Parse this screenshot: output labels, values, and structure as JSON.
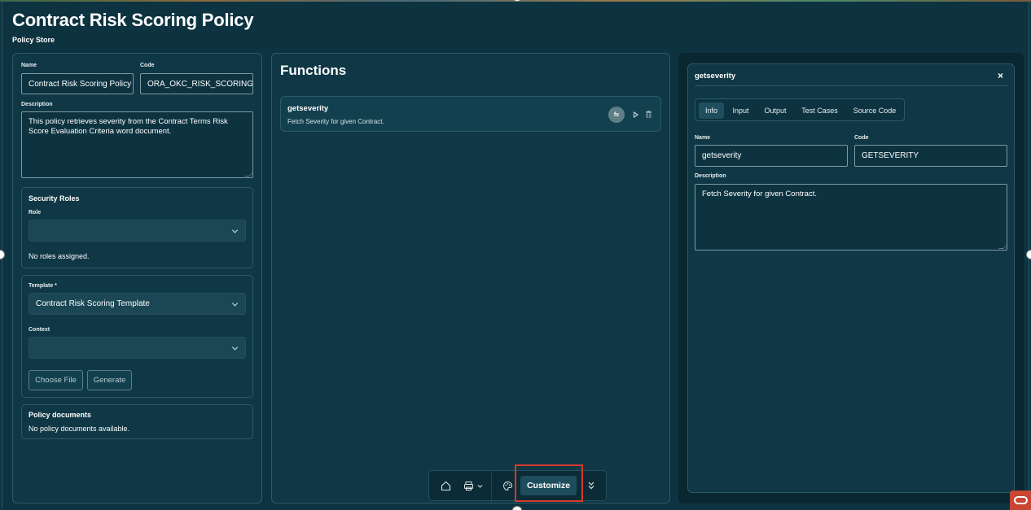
{
  "header": {
    "title": "Contract Risk Scoring Policy",
    "subtitle": "Policy Store"
  },
  "policy_form": {
    "name_label": "Name",
    "name_value": "Contract Risk Scoring Policy",
    "code_label": "Code",
    "code_value": "ORA_OKC_RISK_SCORING_P(",
    "description_label": "Description",
    "description_value": "This policy retrieves severity from the Contract Terms Risk Score Evaluation Criteria word document."
  },
  "security_roles": {
    "title": "Security Roles",
    "role_label": "Role",
    "role_value": "",
    "empty_text": "No roles assigned."
  },
  "template_section": {
    "template_label": "Template *",
    "template_value": "Contract Risk Scoring Template",
    "context_label": "Context",
    "context_value": "",
    "choose_file_label": "Choose File",
    "generate_label": "Generate"
  },
  "policy_documents": {
    "title": "Policy documents",
    "empty_text": "No policy documents available."
  },
  "functions": {
    "title": "Functions",
    "items": [
      {
        "name": "getseverity",
        "description": "Fetch Severity for given Contract.",
        "badge": "fx"
      }
    ]
  },
  "detail_panel": {
    "title": "getseverity",
    "close_glyph": "×",
    "tabs": [
      "Info",
      "Input",
      "Output",
      "Test Cases",
      "Source Code"
    ],
    "active_tab": "Info",
    "name_label": "Name",
    "name_value": "getseverity",
    "code_label": "Code",
    "code_value": "GETSEVERITY",
    "description_label": "Description",
    "description_value": "Fetch Severity for given Contract."
  },
  "dock": {
    "icons": [
      "home-icon",
      "printer-icon",
      "chevron-down-icon",
      "palette-icon",
      "double-chevron-down-icon"
    ],
    "customize_label": "Customize"
  },
  "colors": {
    "background": "#0d3340",
    "panel": "#0f3745",
    "highlight": "#d93a2b",
    "oracle": "#c74634"
  }
}
